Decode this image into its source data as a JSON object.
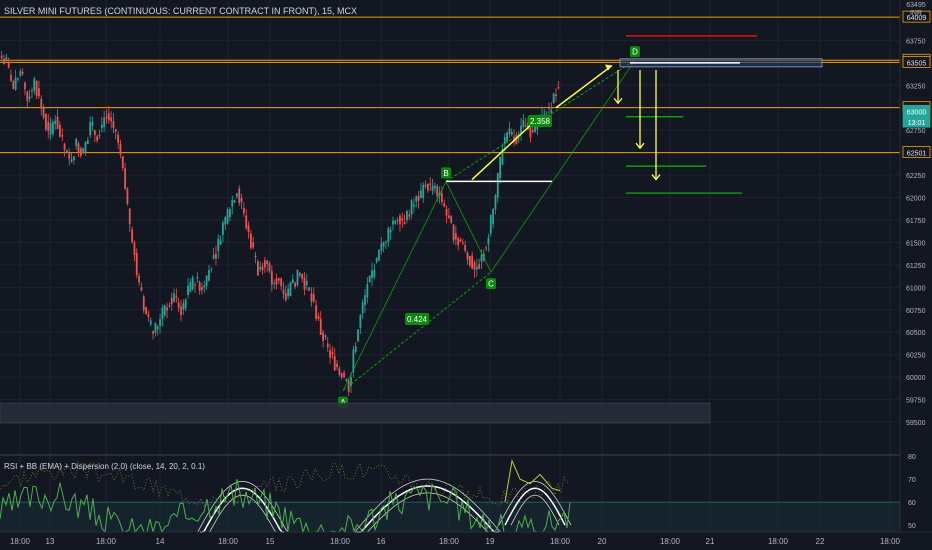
{
  "header": {
    "title": "SILVER MINI FUTURES (CONTINUOUS: CURRENT CONTRACT IN FRONT), 15, MCX",
    "currency_top": "63495",
    "currency_unit": "INR"
  },
  "indicator": {
    "title": "RSI + BB (EMA) + Dispersion (2.0) (close, 14, 20, 2, 0.1)",
    "ticks": [
      "80",
      "70",
      "60",
      "50"
    ]
  },
  "colors": {
    "background": "#131722",
    "up": "#26a69a",
    "down": "#ef5350",
    "level": "#f0a000",
    "green": "#00c000",
    "yellow": "#ffff40",
    "red": "#e01010",
    "white": "#ffffff"
  },
  "chart_data": {
    "type": "candlestick",
    "ylim": [
      59300,
      64200
    ],
    "price_ticks": [
      "63750",
      "63250",
      "63000",
      "62750",
      "62500",
      "62250",
      "62000",
      "61750",
      "61500",
      "61250",
      "61000",
      "60750",
      "60500",
      "60250",
      "60000",
      "59750",
      "59500"
    ],
    "price_labels": [
      {
        "text": "64009",
        "value": 64009,
        "style": "level"
      },
      {
        "text": "63529",
        "value": 63529,
        "style": "level"
      },
      {
        "text": "63505",
        "value": 63505,
        "style": "level"
      },
      {
        "text": "63001",
        "value": 63001,
        "style": "level"
      },
      {
        "text": "63000",
        "value": 62960,
        "style": "current"
      },
      {
        "text": "13:01",
        "value": 62840,
        "style": "current"
      },
      {
        "text": "62501",
        "value": 62501,
        "style": "level"
      }
    ],
    "time_labels": [
      "18:00",
      "13",
      "18:00",
      "14",
      "18:00",
      "15",
      "18:00",
      "16",
      "18:00",
      "19",
      "18:00",
      "20",
      "18:00",
      "21",
      "18:00",
      "22",
      "18:00"
    ],
    "horizontal_levels": [
      64009,
      63529,
      63505,
      63001,
      62501
    ],
    "harmonic_pattern": {
      "points": [
        {
          "label": "A",
          "value": 59850
        },
        {
          "label": "B",
          "value": 62180
        },
        {
          "label": "C",
          "value": 61170
        },
        {
          "label": "D",
          "value": 63530
        }
      ],
      "ratios": [
        "0.424",
        "2.358"
      ]
    },
    "targets": {
      "stop": 63800,
      "entry": 63500,
      "tp1": 62900,
      "tp2": 62350,
      "tp3": 62050
    },
    "close_series": [
      63500,
      63200,
      63400,
      63100,
      63300,
      63000,
      62700,
      62900,
      62600,
      62400,
      62600,
      62500,
      62800,
      62700,
      62900,
      62850,
      62600,
      62100,
      61500,
      61000,
      60700,
      60500,
      60650,
      60800,
      60900,
      60750,
      60950,
      61100,
      61000,
      61200,
      61400,
      61700,
      61900,
      62100,
      61800,
      61500,
      61200,
      61300,
      61050,
      61100,
      60900,
      61050,
      61150,
      61000,
      60800,
      60500,
      60300,
      60150,
      60050,
      59900,
      60400,
      60800,
      61100,
      61300,
      61500,
      61700,
      61800,
      61750,
      61900,
      62000,
      62150,
      62100,
      62050,
      61800,
      61600,
      61500,
      61350,
      61200,
      61300,
      61600,
      62000,
      62600,
      62700,
      62650,
      62800,
      62750,
      62850,
      62900,
      63050,
      63250
    ]
  }
}
